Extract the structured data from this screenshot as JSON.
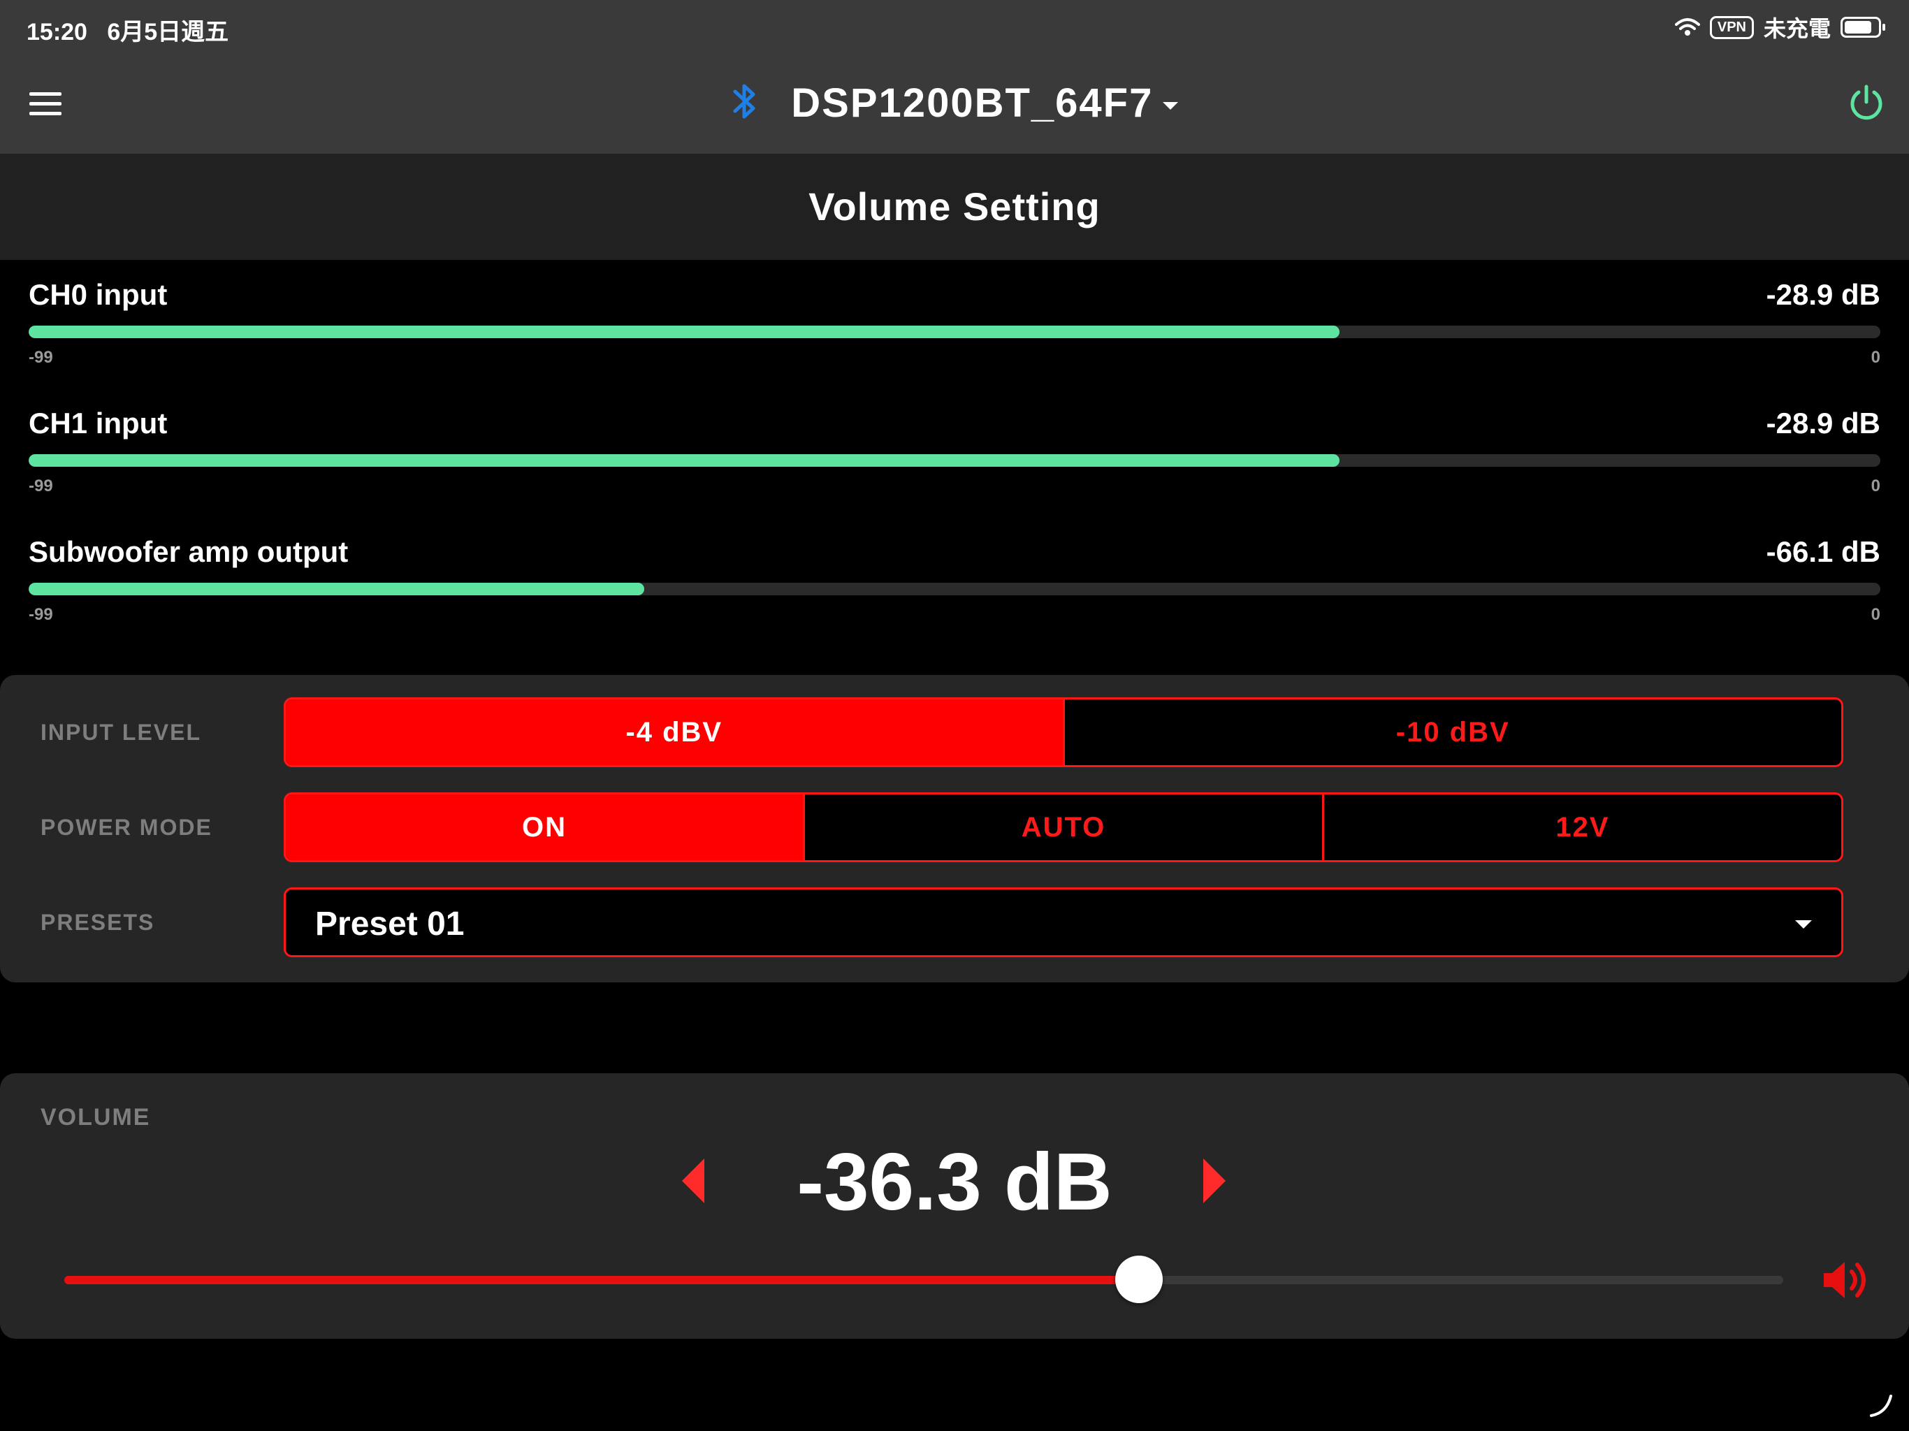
{
  "status_bar": {
    "time": "15:20",
    "date": "6月5日週五",
    "vpn": "VPN",
    "charging": "未充電"
  },
  "header": {
    "device_name": "DSP1200BT_64F7",
    "bluetooth_icon": "bluetooth-icon",
    "menu_icon": "hamburger-menu-icon",
    "power_icon": "power-icon",
    "accent_color": "#5fe3a1",
    "bluetooth_color": "#1e7fe6"
  },
  "page": {
    "title": "Volume Setting"
  },
  "meters": [
    {
      "label": "CH0 input",
      "value": "-28.9 dB",
      "min": "-99",
      "max": "0",
      "level": -28.9
    },
    {
      "label": "CH1 input",
      "value": "-28.9 dB",
      "min": "-99",
      "max": "0",
      "level": -28.9
    },
    {
      "label": "Subwoofer amp output",
      "value": "-66.1 dB",
      "min": "-99",
      "max": "0",
      "level": -66.1
    }
  ],
  "settings": {
    "input_level": {
      "label": "INPUT LEVEL",
      "options": [
        "-4 dBV",
        "-10 dBV"
      ],
      "selected": "-4 dBV"
    },
    "power_mode": {
      "label": "POWER MODE",
      "options": [
        "ON",
        "AUTO",
        "12V"
      ],
      "selected": "ON"
    },
    "presets": {
      "label": "PRESETS",
      "selected": "Preset 01"
    },
    "accent_color": "#ff0000"
  },
  "volume": {
    "label": "VOLUME",
    "display": "-36.3 dB",
    "slider_fraction": 0.625,
    "speaker_icon": "speaker-volume-icon"
  }
}
